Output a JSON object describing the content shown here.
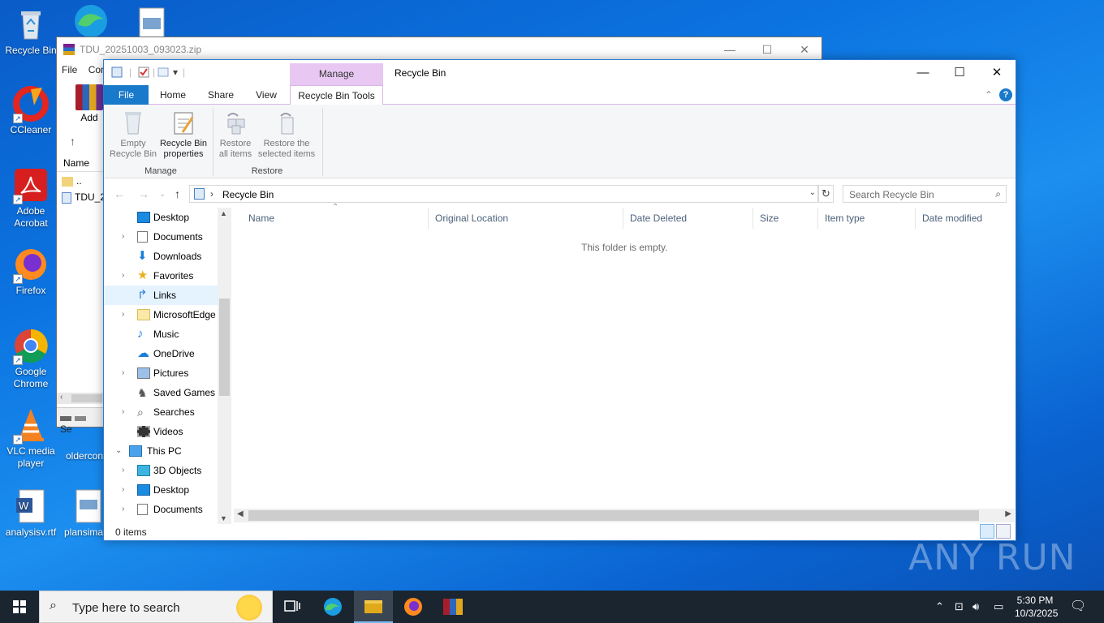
{
  "desktop": {
    "icons": [
      {
        "label": "Recycle Bin"
      },
      {
        "label": "CCleaner"
      },
      {
        "label": "Adobe Acrobat"
      },
      {
        "label": "Firefox"
      },
      {
        "label": "Google Chrome"
      },
      {
        "label": "VLC media player"
      },
      {
        "label": "analysisv.rtf"
      },
      {
        "label": "oldercon"
      },
      {
        "label": "plansima"
      }
    ]
  },
  "winrar": {
    "title": "TDU_20251003_093023.zip",
    "menu": [
      "File",
      "Cor"
    ],
    "add_label": "Add",
    "col_name": "Name",
    "files": [
      "..",
      "TDU_2"
    ],
    "status": "Se"
  },
  "explorer": {
    "title": "Recycle Bin",
    "context_tab_group": "Manage",
    "tabs": [
      "File",
      "Home",
      "Share",
      "View",
      "Recycle Bin Tools"
    ],
    "ribbon": {
      "buttons": [
        {
          "label1": "Empty",
          "label2": "Recycle Bin"
        },
        {
          "label1": "Recycle Bin",
          "label2": "properties"
        },
        {
          "label1": "Restore",
          "label2": "all items"
        },
        {
          "label1": "Restore the",
          "label2": "selected items"
        }
      ],
      "groups": [
        "Manage",
        "Restore"
      ]
    },
    "address": {
      "path": "Recycle Bin",
      "separator": "›"
    },
    "search_placeholder": "Search Recycle Bin",
    "nav_items": [
      {
        "label": "Desktop",
        "chevron": ""
      },
      {
        "label": "Documents",
        "chevron": "›"
      },
      {
        "label": "Downloads",
        "chevron": ""
      },
      {
        "label": "Favorites",
        "chevron": "›"
      },
      {
        "label": "Links",
        "chevron": ""
      },
      {
        "label": "MicrosoftEdge",
        "chevron": "›"
      },
      {
        "label": "Music",
        "chevron": ""
      },
      {
        "label": "OneDrive",
        "chevron": ""
      },
      {
        "label": "Pictures",
        "chevron": "›"
      },
      {
        "label": "Saved Games",
        "chevron": ""
      },
      {
        "label": "Searches",
        "chevron": "›"
      },
      {
        "label": "Videos",
        "chevron": ""
      },
      {
        "label": "This PC",
        "chevron": "⌄"
      },
      {
        "label": "3D Objects",
        "chevron": "›"
      },
      {
        "label": "Desktop",
        "chevron": "›"
      },
      {
        "label": "Documents",
        "chevron": "›"
      }
    ],
    "columns": [
      "Name",
      "Original Location",
      "Date Deleted",
      "Size",
      "Item type",
      "Date modified"
    ],
    "empty_text": "This folder is empty.",
    "status": "0 items"
  },
  "watermark": "ANY RUN",
  "taskbar": {
    "search_placeholder": "Type here to search",
    "time": "5:30 PM",
    "date": "10/3/2025"
  },
  "colors": {
    "accent": "#1979ca",
    "context_tab": "#e8c8f2",
    "taskbar": "#1a2530"
  }
}
